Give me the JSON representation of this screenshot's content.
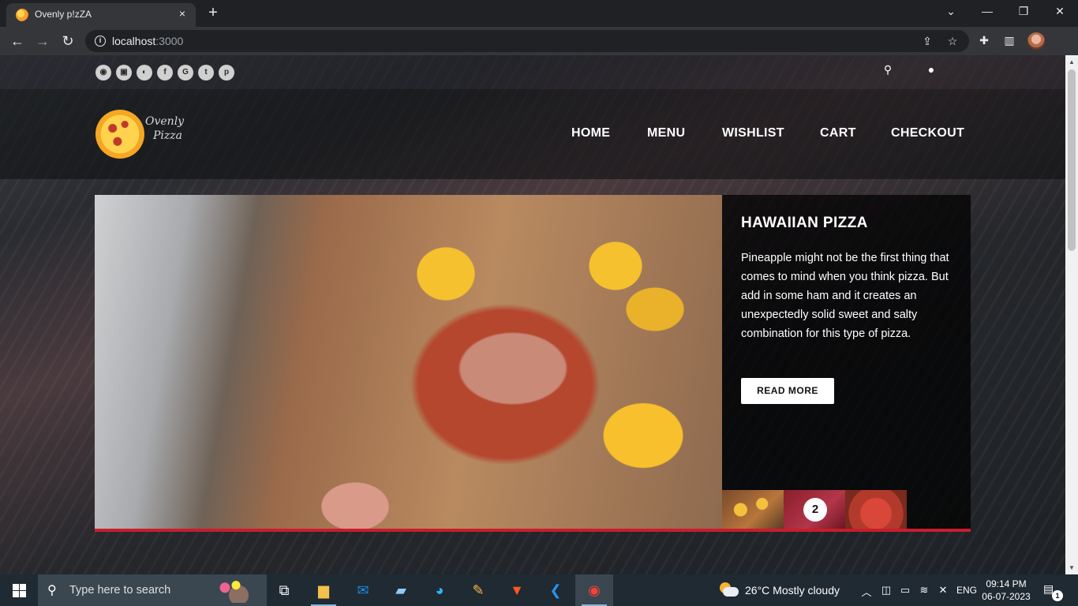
{
  "browser": {
    "tab_title": "Ovenly p!zZA",
    "new_tab_icon": "+",
    "close_tab_icon": "×",
    "url_host": "localhost",
    "url_port": ":3000",
    "window": {
      "minimize": "—",
      "restore": "❐",
      "close": "✕",
      "tab_search": "⌄"
    }
  },
  "site": {
    "social_icons": [
      "rss-icon",
      "twitch-icon",
      "steam-icon",
      "facebook-icon",
      "google-plus-icon",
      "twitter-icon",
      "pinterest-icon"
    ],
    "social_glyphs": [
      "◉",
      "▣",
      "◐",
      "f",
      "G",
      "t",
      "p"
    ],
    "logo_line1": "Ovenly",
    "logo_line2": "Pizza",
    "nav": [
      "HOME",
      "MENU",
      "WISHLIST",
      "CART",
      "CHECKOUT"
    ],
    "hero": {
      "title": "HAWAIIAN PIZZA",
      "description": "Pineapple might not be the first thing that comes to mind when you think pizza. But add in some ham and it creates an unexpectedly solid sweet and salty combination for this type of pizza.",
      "button": "READ MORE",
      "slide_number": "2"
    },
    "accent_color": "#c81d2d"
  },
  "taskbar": {
    "search_placeholder": "Type here to search",
    "weather": "26°C  Mostly cloudy",
    "language": "ENG",
    "time": "09:14 PM",
    "date": "06-07-2023",
    "notification_count": "1"
  }
}
